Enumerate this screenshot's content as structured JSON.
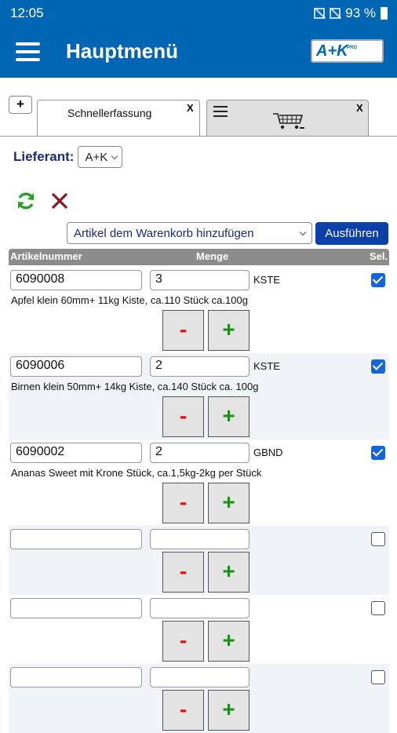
{
  "status_bar": {
    "time": "12:05",
    "battery": "93 %"
  },
  "app_bar": {
    "title": "Hauptmenü",
    "logo_text": "A+K",
    "logo_small": "PRO"
  },
  "tabs": {
    "add_label": "+",
    "active_label": "Schnellerfassung",
    "close_label": "X"
  },
  "supplier": {
    "label": "Lieferant:",
    "value": "A+K"
  },
  "action": {
    "select_value": "Artikel dem Warenkorb hinzufügen",
    "run_label": "Ausführen"
  },
  "table": {
    "headers": [
      "Artikelnummer",
      "Menge",
      "Sel."
    ],
    "rows": [
      {
        "article": "6090008",
        "qty": "3",
        "unit": "KSTE",
        "desc": "Apfel klein 60mm+ 11kg Kiste, ca.110 Stück ca.100g",
        "selected": true
      },
      {
        "article": "6090006",
        "qty": "2",
        "unit": "KSTE",
        "desc": "Birnen klein 50mm+ 14kg Kiste, ca.140 Stück ca. 100g",
        "selected": true
      },
      {
        "article": "6090002",
        "qty": "2",
        "unit": "GBND",
        "desc": "Ananas Sweet mit Krone Stück, ca.1,5kg-2kg per Stück",
        "selected": true
      },
      {
        "article": "",
        "qty": "",
        "unit": "",
        "desc": "",
        "selected": false
      },
      {
        "article": "",
        "qty": "",
        "unit": "",
        "desc": "",
        "selected": false
      },
      {
        "article": "",
        "qty": "",
        "unit": "",
        "desc": "",
        "selected": false
      }
    ],
    "minus_label": "-",
    "plus_label": "+"
  },
  "colors": {
    "primary": "#0066b3",
    "run_button": "#0c3fa8",
    "minus": "#e31515",
    "plus": "#1a8f1a",
    "refresh": "#2a9d2a",
    "delete": "#8b1a1a"
  }
}
